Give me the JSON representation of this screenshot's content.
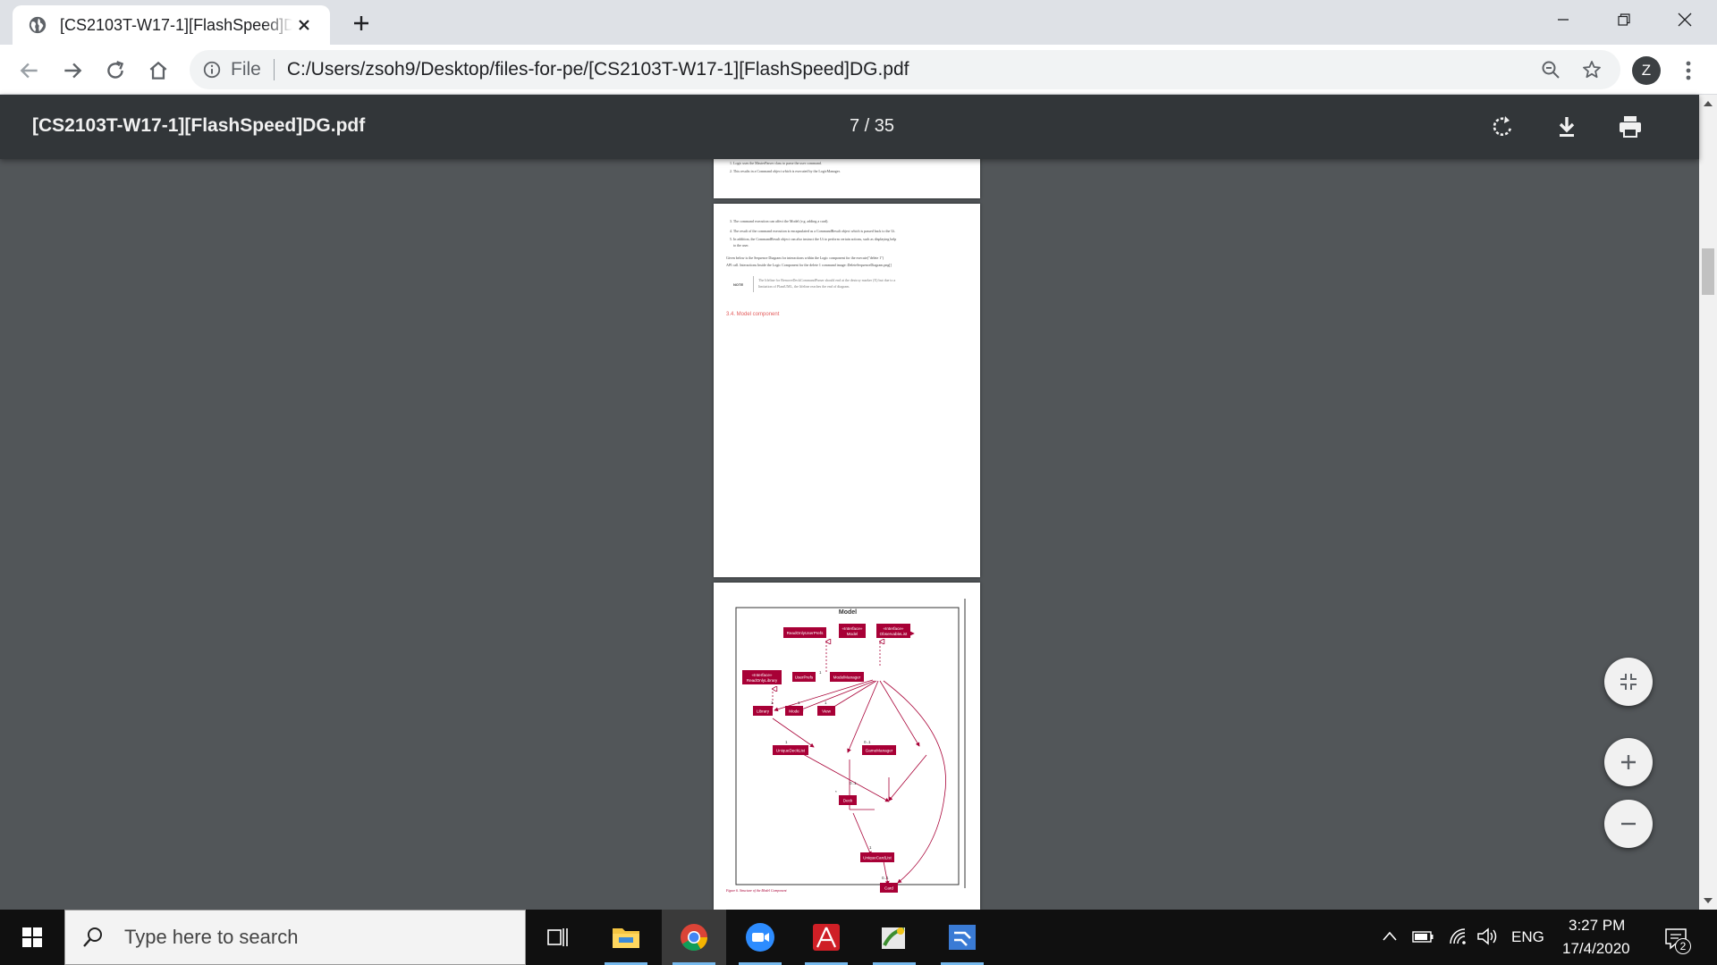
{
  "browser": {
    "tab_title": "[CS2103T-W17-1][FlashSpeed]DG.pdf",
    "omnibox_scheme": "File",
    "omnibox_url": "C:/Users/zsoh9/Desktop/files-for-pe/[CS2103T-W17-1][FlashSpeed]DG.pdf",
    "profile_initial": "Z"
  },
  "pdf": {
    "file_name": "[CS2103T-W17-1][FlashSpeed]DG.pdf",
    "page_indicator": "7 / 35",
    "page6_tail": [
      "1. Logic uses the MasterParser class to parse the user command.",
      "2. This results in a Command object which is executed by the LogicManager."
    ],
    "page7_lines": [
      "3. The command execution can affect the Model (e.g. adding a card).",
      "4. The result of the command execution is encapsulated as a CommandResult object which is passed back to the Ui.",
      "5. In addition, the CommandResult object can also instruct the Ui to perform certain actions, such as displaying help",
      "to the user.",
      "Given below is the Sequence Diagram for interactions within the Logic component for the execute(\"delete 1\")",
      "API call. Interactions Inside the Logic Component for the delete 1 command image::DeleteSequenceDiagram.png[]"
    ],
    "note_label": "NOTE",
    "note_text": [
      "The lifeline for RemoveDeckCommandParser should end at the destroy marker (X) but due to a",
      "limitation of PlantUML, the lifeline reaches the end of diagram."
    ],
    "section_heading": "3.4. Model component",
    "diagram_title": "Model",
    "diagram_nodes": {
      "read_only_user_prefs": "ReadOnlyUserPrefs",
      "model_interface": [
        "«Interface»",
        "Model"
      ],
      "observable_list": [
        "«Interface»",
        "ObservableList"
      ],
      "read_only_library": [
        "«Interface»",
        "ReadOnlyLibrary"
      ],
      "user_prefs": "UserPrefs",
      "model_manager": "ModelManager",
      "library": "Library",
      "mode": "Mode",
      "view": "View",
      "unique_deck_list": "UniqueDeckList",
      "game_manager": "GameManager",
      "deck": "Deck",
      "unique_card_list": "UniqueCardList",
      "card": "Card"
    },
    "diagram_multiplicities": [
      "1",
      "1",
      "1",
      "1",
      "1",
      "0..1",
      "*",
      "0..1",
      "1",
      "0..1"
    ],
    "figure_caption": "Figure 6. Structure of the Model Component"
  },
  "taskbar": {
    "search_placeholder": "Type here to search",
    "language": "ENG",
    "time": "3:27 PM",
    "date": "17/4/2020",
    "notification_count": "2"
  },
  "colors": {
    "pdf_background": "#525659",
    "pdf_header": "#323639",
    "diagram_node": "#a80036",
    "link_heading": "#e35b5b"
  }
}
